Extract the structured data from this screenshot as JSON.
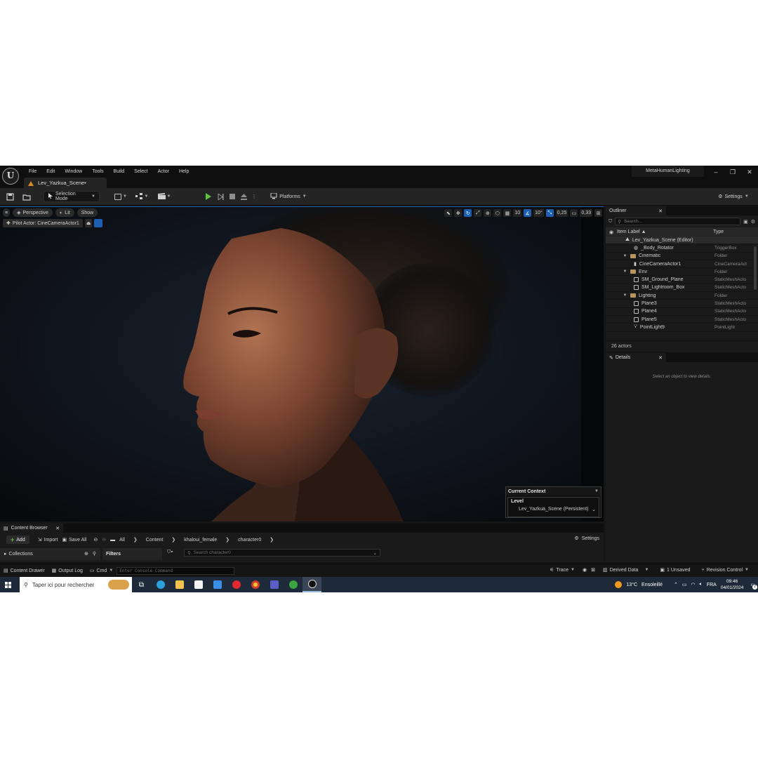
{
  "window": {
    "menu": [
      "File",
      "Edit",
      "Window",
      "Tools",
      "Build",
      "Select",
      "Actor",
      "Help"
    ],
    "tab_title": "Lev_Yazkua_Scene•",
    "project_name": "MetaHumanLighting",
    "controls": {
      "minimize": "–",
      "restore": "❐",
      "close": "✕"
    }
  },
  "toolbar": {
    "mode": "Selection Mode",
    "platforms": "Platforms",
    "settings": "Settings"
  },
  "viewport": {
    "perspective": "Perspective",
    "lit": "Lit",
    "show": "Show",
    "pilot_actor": "Pilot Actor: CineCameraActor1",
    "grid_snap": "10",
    "rotation_snap": "10°",
    "scale_snap": "0,25",
    "camera_speed": "0,33",
    "current_context": {
      "title": "Current Context",
      "level_label": "Level",
      "level_value": "Lev_Yazkua_Scene (Persistent)"
    }
  },
  "outliner": {
    "tab": "Outliner",
    "search_placeholder": "Search...",
    "col_label": "Item Label ▲",
    "col_type": "Type",
    "items": [
      {
        "label": "Lev_Yazkua_Scene (Editor)",
        "type": ""
      },
      {
        "label": "_Body_Rotator",
        "type": "TriggerBox"
      },
      {
        "label": "Cinematic",
        "type": "Folder"
      },
      {
        "label": "CineCameraActor1",
        "type": "CineCameraAct"
      },
      {
        "label": "Env",
        "type": "Folder"
      },
      {
        "label": "SM_Ground_Plane",
        "type": "StaticMeshActo"
      },
      {
        "label": "SM_Lightroom_Box",
        "type": "StaticMeshActo"
      },
      {
        "label": "Lighting",
        "type": "Folder"
      },
      {
        "label": "Plane3",
        "type": "StaticMeshActo"
      },
      {
        "label": "Plane4",
        "type": "StaticMeshActo"
      },
      {
        "label": "Plane5",
        "type": "StaticMeshActo"
      },
      {
        "label": "PointLight9",
        "type": "PointLight"
      }
    ],
    "actor_count": "26 actors"
  },
  "details": {
    "tab": "Details",
    "empty_text": "Select an object to view details."
  },
  "content_browser": {
    "tab": "Content Browser",
    "add": "Add",
    "import": "Import",
    "save_all": "Save All",
    "breadcrumb": [
      "All",
      "Content",
      "khaloui_female",
      "character0"
    ],
    "settings": "Settings",
    "collections": "Collections",
    "filters": "Filters",
    "search_placeholder": "Search character0"
  },
  "statusbar": {
    "content_drawer": "Content Drawer",
    "output_log": "Output Log",
    "cmd": "Cmd",
    "console_placeholder": "Enter Console Command",
    "trace": "Trace",
    "derived_data": "Derived Data",
    "unsaved": "1 Unsaved",
    "revision_control": "Revision Control"
  },
  "taskbar": {
    "search_placeholder": "Taper ici pour rechercher",
    "weather_temp": "13°C",
    "weather_desc": "Ensoleillé",
    "language": "FRA",
    "time": "09:46",
    "date": "04/01/2024",
    "notif_count": "2"
  }
}
